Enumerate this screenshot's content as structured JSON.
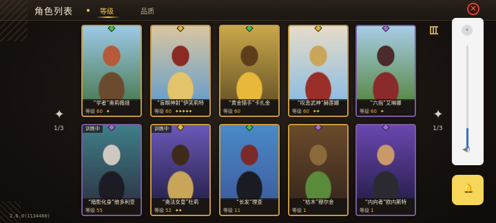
{
  "header": {
    "title": "角色列表",
    "tabs": [
      {
        "label": "等级",
        "active": true
      },
      {
        "label": "品质",
        "active": false
      }
    ],
    "close_icon": "close-icon",
    "filter_icon": "filter-icon"
  },
  "pagination": {
    "left": "1/3",
    "right": "1/3"
  },
  "cards": [
    {
      "name": "“学者”奥莉薇娅",
      "level_label": "等级",
      "level": "60",
      "stars": "✦",
      "frame": "gold",
      "gem": "#3fc24a",
      "training": "",
      "art": [
        "#4e7e5a",
        "#9cc9e6",
        "#6b4a2e",
        "#b65a3a"
      ]
    },
    {
      "name": "“盲眼神射”伊芙莉特",
      "level_label": "等级",
      "level": "60",
      "stars": "✦✦✦✦✦",
      "frame": "gold",
      "gem": "#e3b23a",
      "training": "",
      "art": [
        "#6d9fc8",
        "#d9c6a0",
        "#e3c46a",
        "#8b2a22"
      ]
    },
    {
      "name": "“黄金猎手”卡扎金",
      "level_label": "等级",
      "level": "60",
      "stars": "",
      "frame": "gold",
      "gem": "#3fc24a",
      "training": "",
      "art": [
        "#6d5a2a",
        "#caa74a",
        "#e8b83a",
        "#5e3e1a"
      ]
    },
    {
      "name": "“叹息武神”赫莲娜",
      "level_label": "等级",
      "level": "60",
      "stars": "✦✦",
      "frame": "gold",
      "gem": "#e3b23a",
      "training": "",
      "art": [
        "#8fbde0",
        "#e6dcc8",
        "#9a2e28",
        "#c9a55a"
      ]
    },
    {
      "name": "“六指”艾琳娜",
      "level_label": "等级",
      "level": "60",
      "stars": "✦",
      "frame": "purple",
      "gem": "#a36ad8",
      "training": "",
      "art": [
        "#5a8a4a",
        "#a8cde6",
        "#8a2a2a",
        "#4a2a2a"
      ]
    },
    {
      "name": "“暗影化身”维多利亚",
      "level_label": "等级",
      "level": "55",
      "stars": "",
      "frame": "purple",
      "gem": "#a36ad8",
      "training": "训练中",
      "art": [
        "#2f3a4a",
        "#3e7f88",
        "#1c1c24",
        "#cfc8c0"
      ]
    },
    {
      "name": "“奥法女皇”杜莉",
      "level_label": "等级",
      "level": "52",
      "stars": "✦✦",
      "frame": "gold",
      "gem": "#e3b23a",
      "training": "训练中",
      "art": [
        "#2a2450",
        "#6a58b8",
        "#c9a55a",
        "#3e2a18"
      ]
    },
    {
      "name": "“长发”理查",
      "level_label": "等级",
      "level": "11",
      "stars": "",
      "frame": "gold",
      "gem": "#3fc24a",
      "training": "",
      "art": [
        "#3e5fa0",
        "#4a8ac8",
        "#1a1c24",
        "#7a2a2a"
      ]
    },
    {
      "name": "“枯木”穆尔金",
      "level_label": "等级",
      "level": "1",
      "stars": "",
      "frame": "gold",
      "gem": "#a36ad8",
      "training": "",
      "art": [
        "#3a2a1e",
        "#6a4a2a",
        "#5a8a3a",
        "#8a6a3a"
      ]
    },
    {
      "name": "“内向者”欧内斯特",
      "level_label": "等级",
      "level": "1",
      "stars": "",
      "frame": "purple",
      "gem": "#a36ad8",
      "training": "",
      "art": [
        "#2a2050",
        "#6a48b0",
        "#2a2a30",
        "#c89a6a"
      ]
    }
  ],
  "side_panel": {
    "up_icon": "chevron-left-icon",
    "volume_level": 0.2,
    "speaker_icon": "speaker-icon",
    "bell_icon": "bell-icon"
  },
  "footer": {
    "version": "2.6.0(1134460)"
  }
}
